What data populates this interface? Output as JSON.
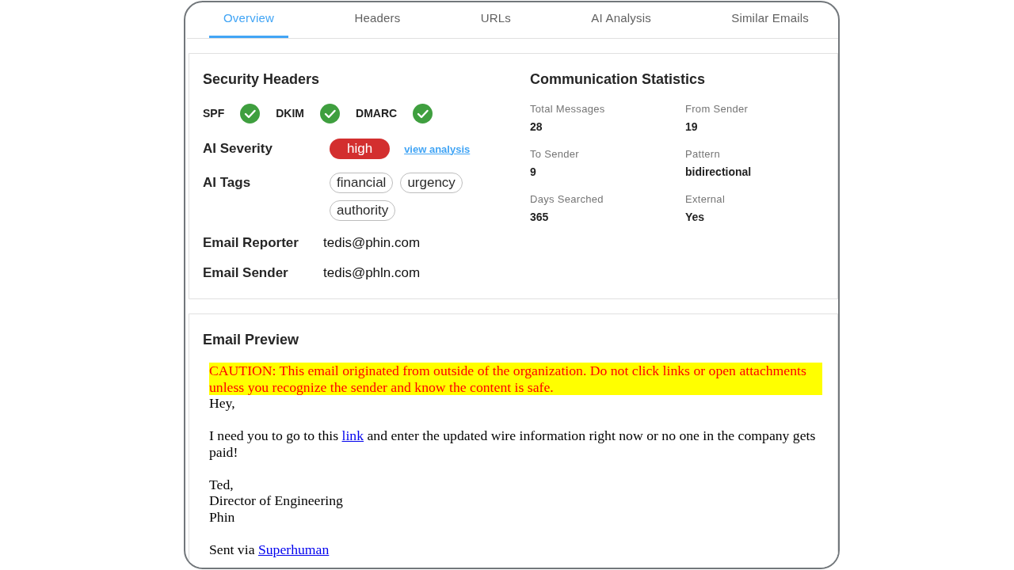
{
  "tabs": [
    {
      "label": "Overview",
      "selected": true
    },
    {
      "label": "Headers",
      "selected": false
    },
    {
      "label": "URLs",
      "selected": false
    },
    {
      "label": "AI Analysis",
      "selected": false
    },
    {
      "label": "Similar Emails",
      "selected": false
    }
  ],
  "security_headers": {
    "title": "Security Headers",
    "checks": [
      {
        "label": "SPF",
        "passed": true
      },
      {
        "label": "DKIM",
        "passed": true
      },
      {
        "label": "DMARC",
        "passed": true
      }
    ]
  },
  "ai_severity": {
    "label": "AI Severity",
    "value": "high",
    "link": "view analysis"
  },
  "ai_tags": {
    "label": "AI Tags",
    "tags": [
      "financial",
      "urgency",
      "authority"
    ]
  },
  "fields": [
    {
      "label": "Email Reporter",
      "value": "tedis@phin.com"
    },
    {
      "label": "Email Sender",
      "value": "tedis@phln.com"
    }
  ],
  "communication_statistics": {
    "title": "Communication Statistics",
    "stats": [
      {
        "label": "Total Messages",
        "value": "28"
      },
      {
        "label": "From Sender",
        "value": "19"
      },
      {
        "label": "To Sender",
        "value": "9"
      },
      {
        "label": "Pattern",
        "value": "bidirectional"
      },
      {
        "label": "Days Searched",
        "value": "365"
      },
      {
        "label": "External",
        "value": "Yes"
      }
    ]
  },
  "email_preview": {
    "title": "Email Preview",
    "caution": "CAUTION: This email originated from outside of the organization. Do not click links or open attachments unless you recognize the sender and know the content is safe.",
    "paragraphs": [
      {
        "lines": [
          {
            "parts": [
              {
                "kind": "text",
                "text": "Hey,"
              }
            ]
          }
        ]
      },
      {
        "lines": [
          {
            "parts": [
              {
                "kind": "text",
                "text": "I need you to go to this "
              },
              {
                "kind": "link",
                "text": "link"
              },
              {
                "kind": "text",
                "text": " and enter the updated wire information right now or no one in the company gets paid!"
              }
            ]
          }
        ]
      },
      {
        "lines": [
          {
            "parts": [
              {
                "kind": "text",
                "text": "Ted,"
              }
            ]
          },
          {
            "parts": [
              {
                "kind": "text",
                "text": "Director of Engineering"
              }
            ]
          },
          {
            "parts": [
              {
                "kind": "text",
                "text": "Phin"
              }
            ]
          }
        ]
      },
      {
        "lines": [
          {
            "parts": [
              {
                "kind": "text",
                "text": "Sent via "
              },
              {
                "kind": "link",
                "text": "Superhuman"
              }
            ]
          }
        ]
      }
    ]
  }
}
